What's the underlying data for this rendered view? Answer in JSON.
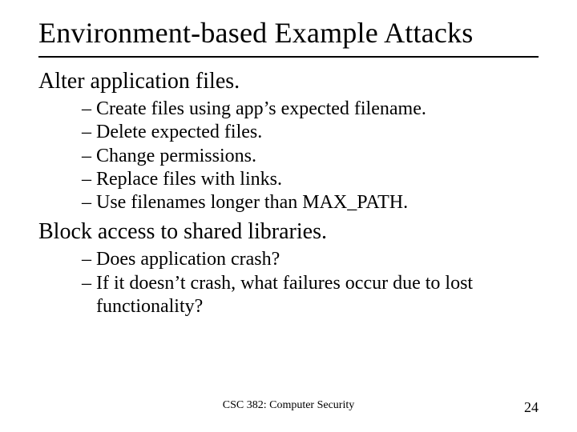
{
  "title": "Environment-based Example Attacks",
  "sections": [
    {
      "heading": "Alter application files.",
      "items": [
        "Create files using app’s expected filename.",
        "Delete expected files.",
        "Change permissions.",
        "Replace files with links.",
        "Use filenames longer than MAX_PATH."
      ]
    },
    {
      "heading": "Block access to shared libraries.",
      "items": [
        "Does application crash?",
        "If it doesn’t crash, what failures occur due to lost functionality?"
      ]
    }
  ],
  "footer": {
    "course": "CSC 382: Computer Security",
    "page": "24"
  },
  "dash": "– "
}
